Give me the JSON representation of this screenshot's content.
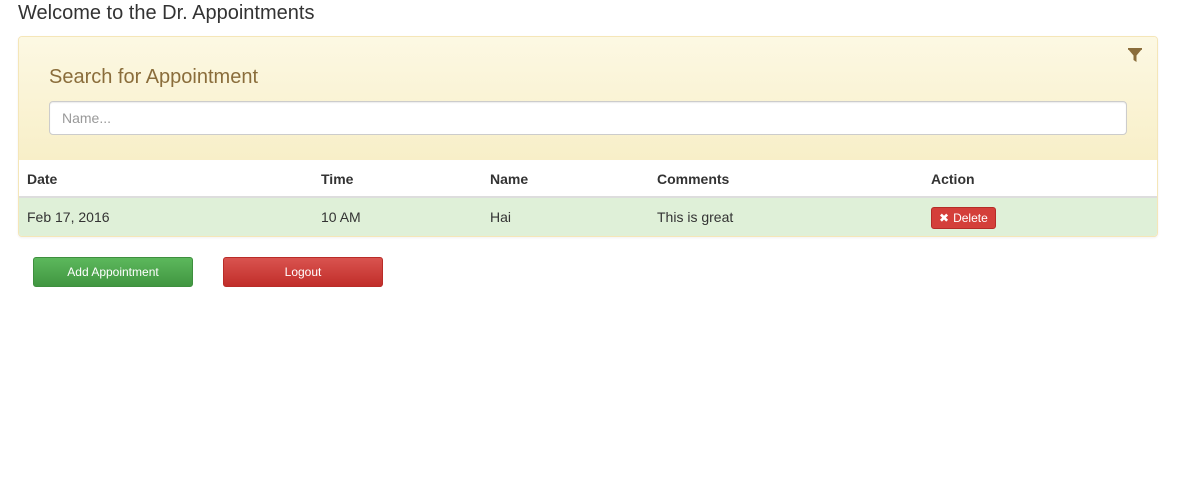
{
  "page": {
    "title": "Welcome to the Dr. Appointments"
  },
  "search": {
    "heading": "Search for Appointment",
    "placeholder": "Name...",
    "value": "",
    "filter_icon": "filter-icon"
  },
  "table": {
    "columns": [
      "Date",
      "Time",
      "Name",
      "Comments",
      "Action"
    ],
    "rows": [
      {
        "date": "Feb 17, 2016",
        "time": "10 AM",
        "name": "Hai",
        "comments": "This is great",
        "action_label": "Delete",
        "action_icon": "x-icon"
      }
    ]
  },
  "buttons": {
    "add_label": "Add Appointment",
    "logout_label": "Logout"
  },
  "colors": {
    "panel_bg": "#fcf8e3",
    "heading_text": "#8a6d3b",
    "row_success": "#dff0d8",
    "add_button": "#5cb85c",
    "danger_button": "#d9534f"
  }
}
